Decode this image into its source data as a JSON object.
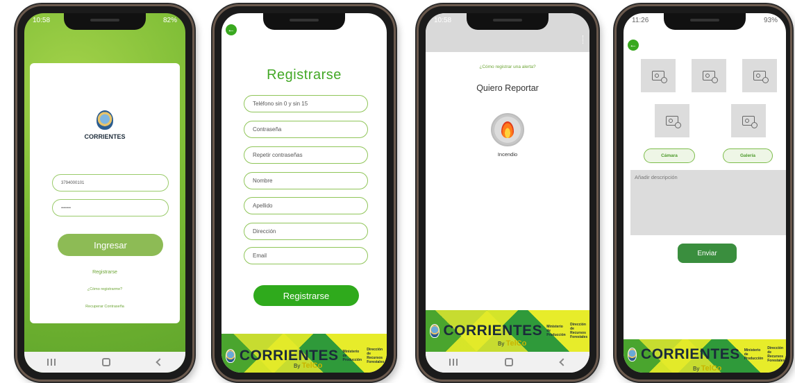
{
  "screen1": {
    "status_time": "10:58",
    "status_right": "82%",
    "logo_text": "CORRIENTES",
    "phone_value": "3794000101",
    "password_value": "••••••••",
    "login_button": "Ingresar",
    "register_link": "Registrarse",
    "how_register_link": "¿Cómo registrarme?",
    "recover_link": "Recuperar Contraseña"
  },
  "screen2": {
    "title": "Registrarse",
    "fields": [
      "Teléfono sin 0 y sin 15",
      "Contraseña",
      "Repetir contraseñas",
      "Nombre",
      "Apellido",
      "Dirección",
      "Email"
    ],
    "submit_button": "Registrarse",
    "footer_logo": "CORRIENTES",
    "footer_org1": "Ministerio de Producción",
    "footer_org2": "Dirección de Recursos Forestales",
    "footer_by": "By",
    "footer_brand": "TelCo"
  },
  "screen3": {
    "status_time": "10:58",
    "help_link": "¿Cómo registrar una alerta?",
    "heading": "Quiero Reportar",
    "option_label": "Incendio",
    "footer_logo": "CORRIENTES",
    "footer_org1": "Ministerio de Producción",
    "footer_org2": "Dirección de Recursos Forestales",
    "footer_by": "By",
    "footer_brand": "TelCo"
  },
  "screen4": {
    "status_time": "11:26",
    "status_right": "93%",
    "camera_button": "Cámara",
    "gallery_button": "Galería",
    "description_placeholder": "Añadir descripción",
    "send_button": "Enviar",
    "footer_logo": "CORRIENTES",
    "footer_org1": "Ministerio de Producción",
    "footer_org2": "Dirección de Recursos Forestales",
    "footer_by": "By",
    "footer_brand": "TelCo"
  },
  "colors": {
    "primary_green": "#3aac1f",
    "light_green": "#8fbe52",
    "link_green": "#4f9a2a"
  }
}
